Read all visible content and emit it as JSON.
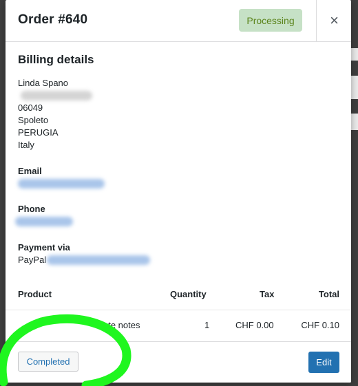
{
  "modal": {
    "title": "Order #640",
    "status_badge": "Processing",
    "close_symbol": "×"
  },
  "billing": {
    "heading": "Billing details",
    "name": "Linda Spano",
    "postcode": "06049",
    "city": "Spoleto",
    "province": "PERUGIA",
    "country": "Italy"
  },
  "email": {
    "label": "Email"
  },
  "phone": {
    "label": "Phone"
  },
  "payment": {
    "label": "Payment via",
    "method": "PayPal"
  },
  "products": {
    "headers": {
      "product": "Product",
      "quantity": "Quantity",
      "tax": "Tax",
      "total": "Total"
    },
    "rows": [
      {
        "product": "ate notes",
        "quantity": "1",
        "tax": "CHF 0.00",
        "total": "CHF 0.10"
      }
    ]
  },
  "footer": {
    "completed_label": "Completed",
    "edit_label": "Edit"
  },
  "colors": {
    "badge_bg": "#c6e1c6",
    "badge_text": "#5b841b",
    "primary": "#2271b1",
    "annotation_green": "#1ff61f"
  }
}
